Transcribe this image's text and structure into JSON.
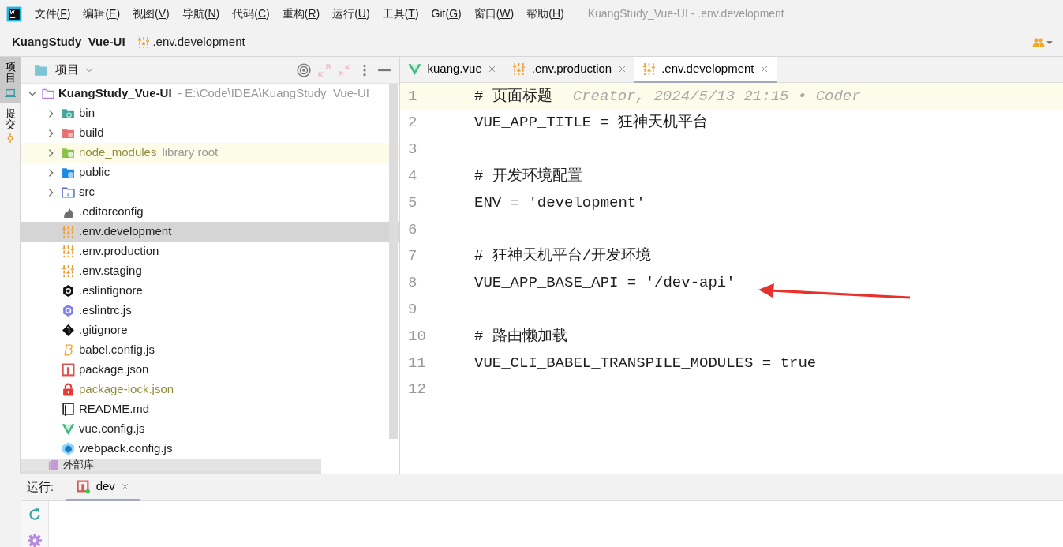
{
  "menu_bar": {
    "items": [
      "文件(F)",
      "编辑(E)",
      "视图(V)",
      "导航(N)",
      "代码(C)",
      "重构(R)",
      "运行(U)",
      "工具(T)",
      "Git(G)",
      "窗口(W)",
      "帮助(H)"
    ],
    "title": "KuangStudy_Vue-UI - .env.development"
  },
  "breadcrumb": {
    "project": "KuangStudy_Vue-UI",
    "file": ".env.development"
  },
  "tool_strip": [
    {
      "label": "项目",
      "kind": "project",
      "selected": true
    },
    {
      "label": "提交",
      "kind": "commit",
      "selected": false
    }
  ],
  "project_panel": {
    "title": "项目",
    "root": {
      "name": "KuangStudy_Vue-UI",
      "path": "- E:\\Code\\IDEA\\KuangStudy_Vue-UI",
      "expanded": true,
      "children": [
        {
          "name": "bin",
          "kind": "folder-test",
          "expanded": false,
          "selected": false,
          "ignored": false
        },
        {
          "name": "build",
          "kind": "folder-build",
          "expanded": false,
          "selected": false,
          "ignored": false
        },
        {
          "name": "node_modules",
          "kind": "folder-library",
          "hint": "library root",
          "expanded": false,
          "selected": false,
          "ignored": true
        },
        {
          "name": "public",
          "kind": "folder-web",
          "expanded": false,
          "selected": false,
          "ignored": false
        },
        {
          "name": "src",
          "kind": "folder-source",
          "expanded": false,
          "selected": false,
          "ignored": false
        },
        {
          "name": ".editorconfig",
          "kind": "editorconfig",
          "selected": false,
          "ignored": false
        },
        {
          "name": ".env.development",
          "kind": "env",
          "selected": true,
          "ignored": false
        },
        {
          "name": ".env.production",
          "kind": "env",
          "selected": false,
          "ignored": false
        },
        {
          "name": ".env.staging",
          "kind": "env",
          "selected": false,
          "ignored": false
        },
        {
          "name": ".eslintignore",
          "kind": "eslintignore",
          "selected": false,
          "ignored": false
        },
        {
          "name": ".eslintrc.js",
          "kind": "eslint",
          "selected": false,
          "ignored": false
        },
        {
          "name": ".gitignore",
          "kind": "git",
          "selected": false,
          "ignored": false
        },
        {
          "name": "babel.config.js",
          "kind": "babel",
          "selected": false,
          "ignored": false
        },
        {
          "name": "package.json",
          "kind": "npm",
          "selected": false,
          "ignored": false
        },
        {
          "name": "package-lock.json",
          "kind": "lock",
          "selected": false,
          "ignored": true
        },
        {
          "name": "README.md",
          "kind": "readme",
          "selected": false,
          "ignored": false
        },
        {
          "name": "vue.config.js",
          "kind": "vue",
          "selected": false,
          "ignored": false
        },
        {
          "name": "webpack.config.js",
          "kind": "webpack",
          "selected": false,
          "ignored": false
        }
      ]
    },
    "external": "外部库"
  },
  "editor": {
    "tabs": [
      {
        "label": "kuang.vue",
        "kind": "vue",
        "selected": false
      },
      {
        "label": ".env.production",
        "kind": "env",
        "selected": false
      },
      {
        "label": ".env.development",
        "kind": "env",
        "selected": true
      }
    ],
    "lines": [
      {
        "number": "1",
        "text": "# 页面标题",
        "annotation": "Creator, 2024/5/13 21:15 • Coder",
        "current": true
      },
      {
        "number": "2",
        "text": "VUE_APP_TITLE = 狂神天机平台",
        "current": false
      },
      {
        "number": "3",
        "current": false
      },
      {
        "number": "4",
        "text": "# 开发环境配置",
        "current": false
      },
      {
        "number": "5",
        "text": "ENV = 'development'",
        "current": false
      },
      {
        "number": "6",
        "current": false
      },
      {
        "number": "7",
        "text": "# 狂神天机平台/开发环境",
        "current": false
      },
      {
        "number": "8",
        "text": "VUE_APP_BASE_API = '/dev-api'",
        "current": false
      },
      {
        "number": "9",
        "current": false
      },
      {
        "number": "10",
        "text": "# 路由懒加载",
        "current": false
      },
      {
        "number": "11",
        "text": "VUE_CLI_BABEL_TRANSPILE_MODULES = true",
        "current": false
      },
      {
        "number": "12",
        "current": false
      }
    ]
  },
  "run_panel": {
    "label": "运行:",
    "tabs": [
      {
        "label": "dev",
        "selected": true
      }
    ]
  }
}
